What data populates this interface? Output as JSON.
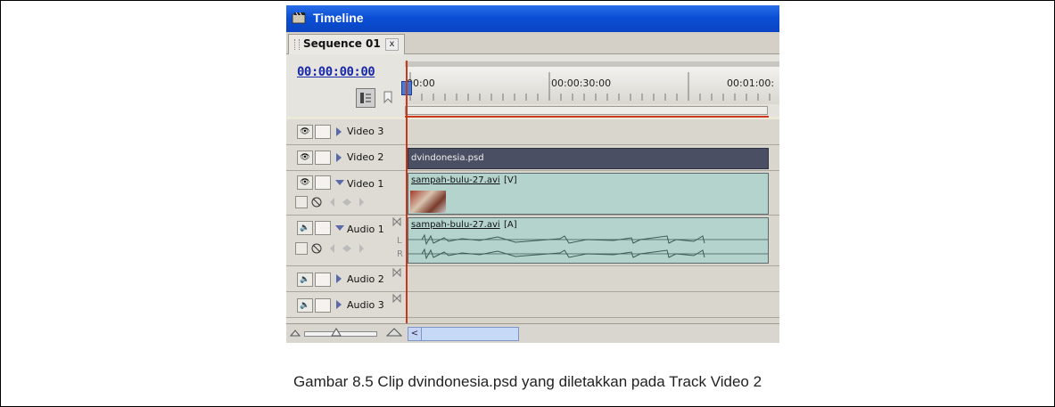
{
  "window": {
    "title": "Timeline"
  },
  "tab": {
    "label": "Sequence 01",
    "close": "x"
  },
  "timecode": "00:00:00:00",
  "ruler": {
    "ticks": [
      "00:00",
      "00:00:30:00",
      "00:01:00:"
    ]
  },
  "tracks": {
    "video3": "Video 3",
    "video2": "Video 2",
    "video1": "Video 1",
    "audio1": "Audio 1",
    "audio2": "Audio 2",
    "audio3": "Audio 3",
    "audio_channel_l": "L",
    "audio_channel_r": "R"
  },
  "clips": {
    "video2_clip": "dvindonesia.psd",
    "video1_clip_name": "sampah-bulu-27.avi",
    "video1_clip_tag": "[V]",
    "audio1_clip_name": "sampah-bulu-27.avi",
    "audio1_clip_tag": "[A]"
  },
  "caption": "Gambar 8.5 Clip dvindonesia.psd yang diletakkan pada Track Video 2",
  "colors": {
    "titlebar": "#0b4fd6",
    "timecode": "#1a2aa8",
    "playhead": "#c8391b",
    "video2_clip": "#4b4f63",
    "video1_clip": "#b4d3cc",
    "audio1_clip": "#b4d3cc"
  },
  "icons": [
    "premiere-app-icon",
    "eye-icon",
    "speaker-icon",
    "snap-icon",
    "marker-icon",
    "keyframe-nav-icon",
    "zoom-out-icon",
    "zoom-in-icon",
    "sync-lock-icon"
  ]
}
